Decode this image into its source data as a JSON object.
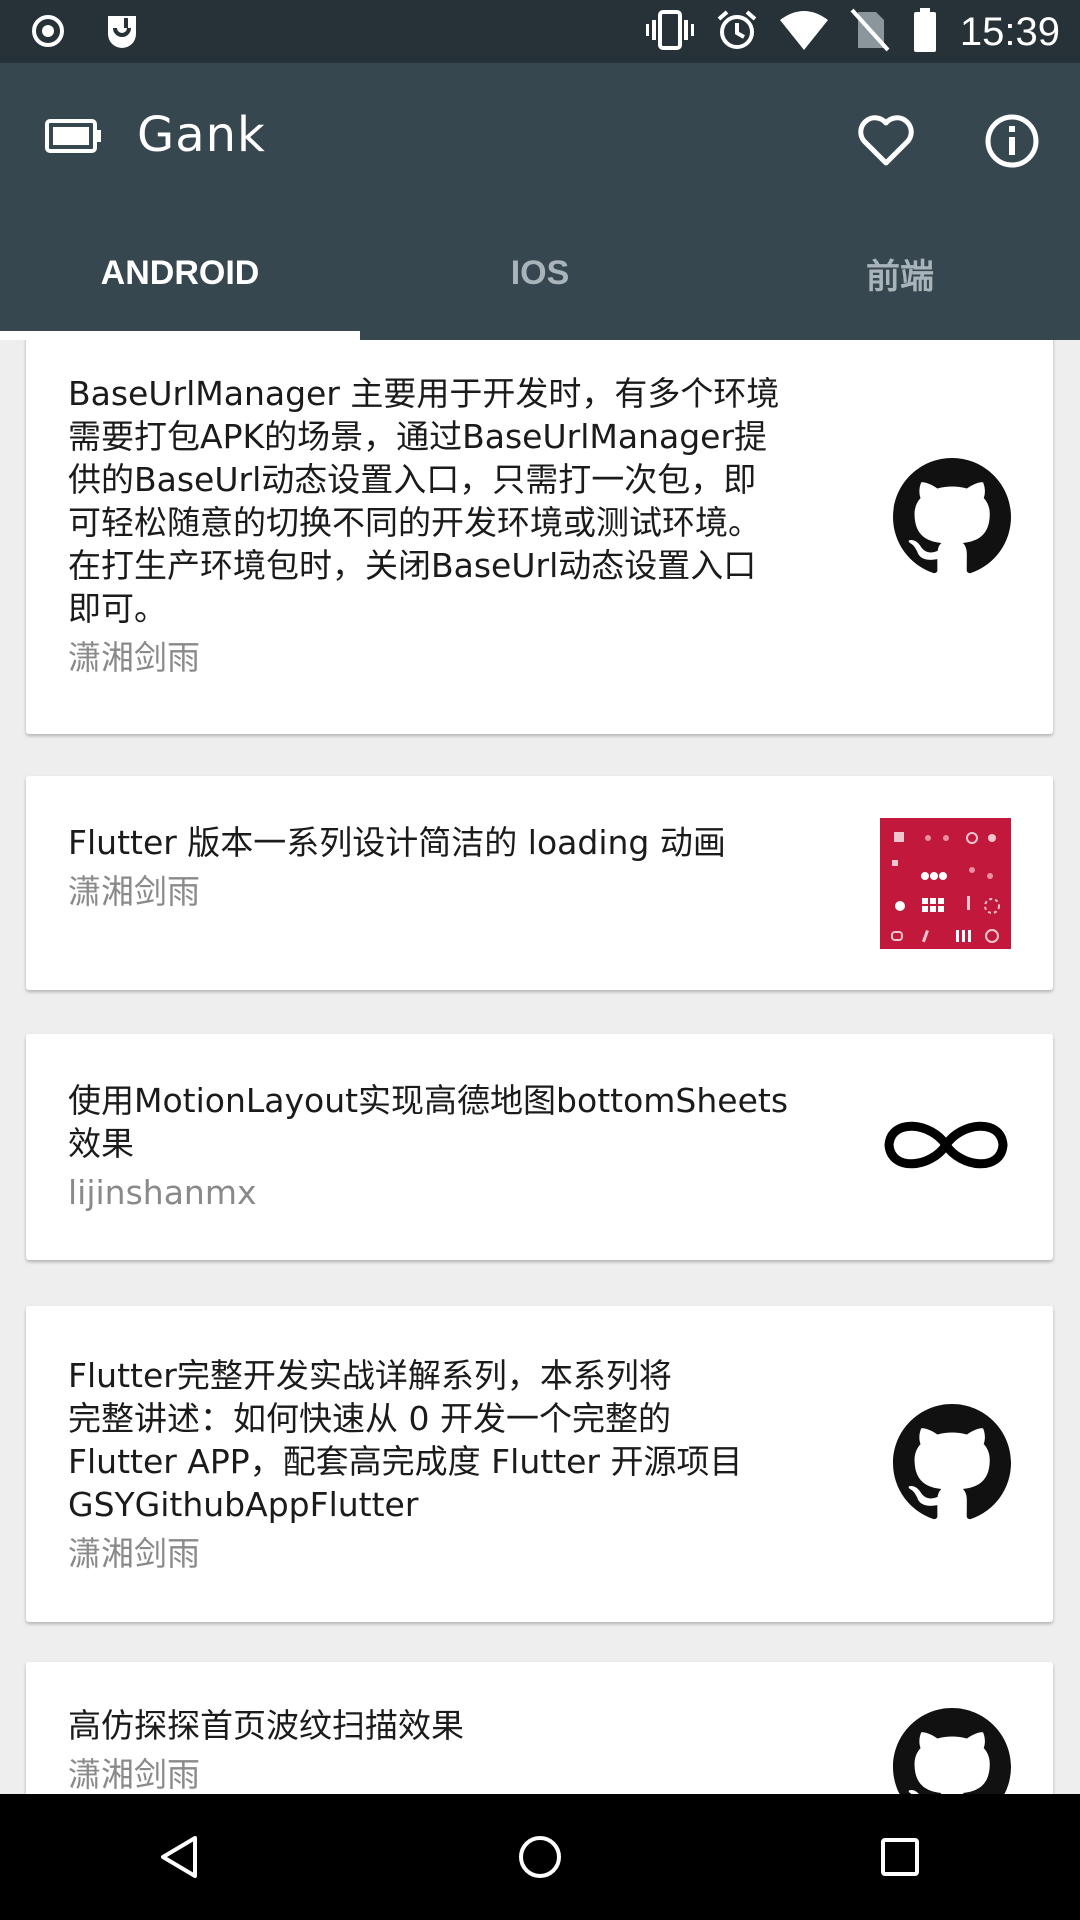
{
  "status_bar": {
    "time": "15:39",
    "left_icons": [
      "record-icon",
      "app-notification-icon"
    ],
    "right_icons": [
      "vibrate-icon",
      "alarm-icon",
      "wifi-icon",
      "no-sim-icon",
      "battery-icon"
    ]
  },
  "app_bar": {
    "title": "Gank",
    "nav_icon": "battery-outline-icon",
    "actions": [
      "heart-icon",
      "info-icon"
    ],
    "colors": {
      "toolbar": "#37474f",
      "statusbar": "#263238"
    }
  },
  "tabs": [
    {
      "label": "ANDROID",
      "active": true
    },
    {
      "label": "IOS",
      "active": false
    },
    {
      "label": "前端",
      "active": false
    }
  ],
  "items": [
    {
      "lines": [
        "BaseUrlManager 主要用于开发时，有多个环境",
        "需要打包APK的场景，通过BaseUrlManager提",
        "供的BaseUrl动态设置入口，只需打一次包，即",
        "可轻松随意的切换不同的开发环境或测试环境。",
        "在打生产环境包时，关闭BaseUrl动态设置入口",
        "即可。"
      ],
      "author": "潇湘剑雨",
      "thumb": "github-icon"
    },
    {
      "lines": [
        "Flutter 版本一系列设计简洁的 loading 动画"
      ],
      "author": "潇湘剑雨",
      "thumb": "loading-preview-image"
    },
    {
      "lines": [
        "使用MotionLayout实现高德地图bottomSheets",
        "效果"
      ],
      "author": "lijinshanmx",
      "thumb": "infinity-icon"
    },
    {
      "lines": [
        "Flutter完整开发实战详解系列，本系列将",
        "完整讲述：如何快速从 0 开发一个完整的",
        "Flutter APP，配套高完成度 Flutter 开源项目",
        "GSYGithubAppFlutter"
      ],
      "author": "潇湘剑雨",
      "thumb": "github-icon"
    },
    {
      "lines": [
        "高仿探探首页波纹扫描效果"
      ],
      "author": "潇湘剑雨",
      "thumb": "github-icon"
    }
  ],
  "nav_bar": [
    "back-icon",
    "home-icon",
    "recents-icon"
  ]
}
